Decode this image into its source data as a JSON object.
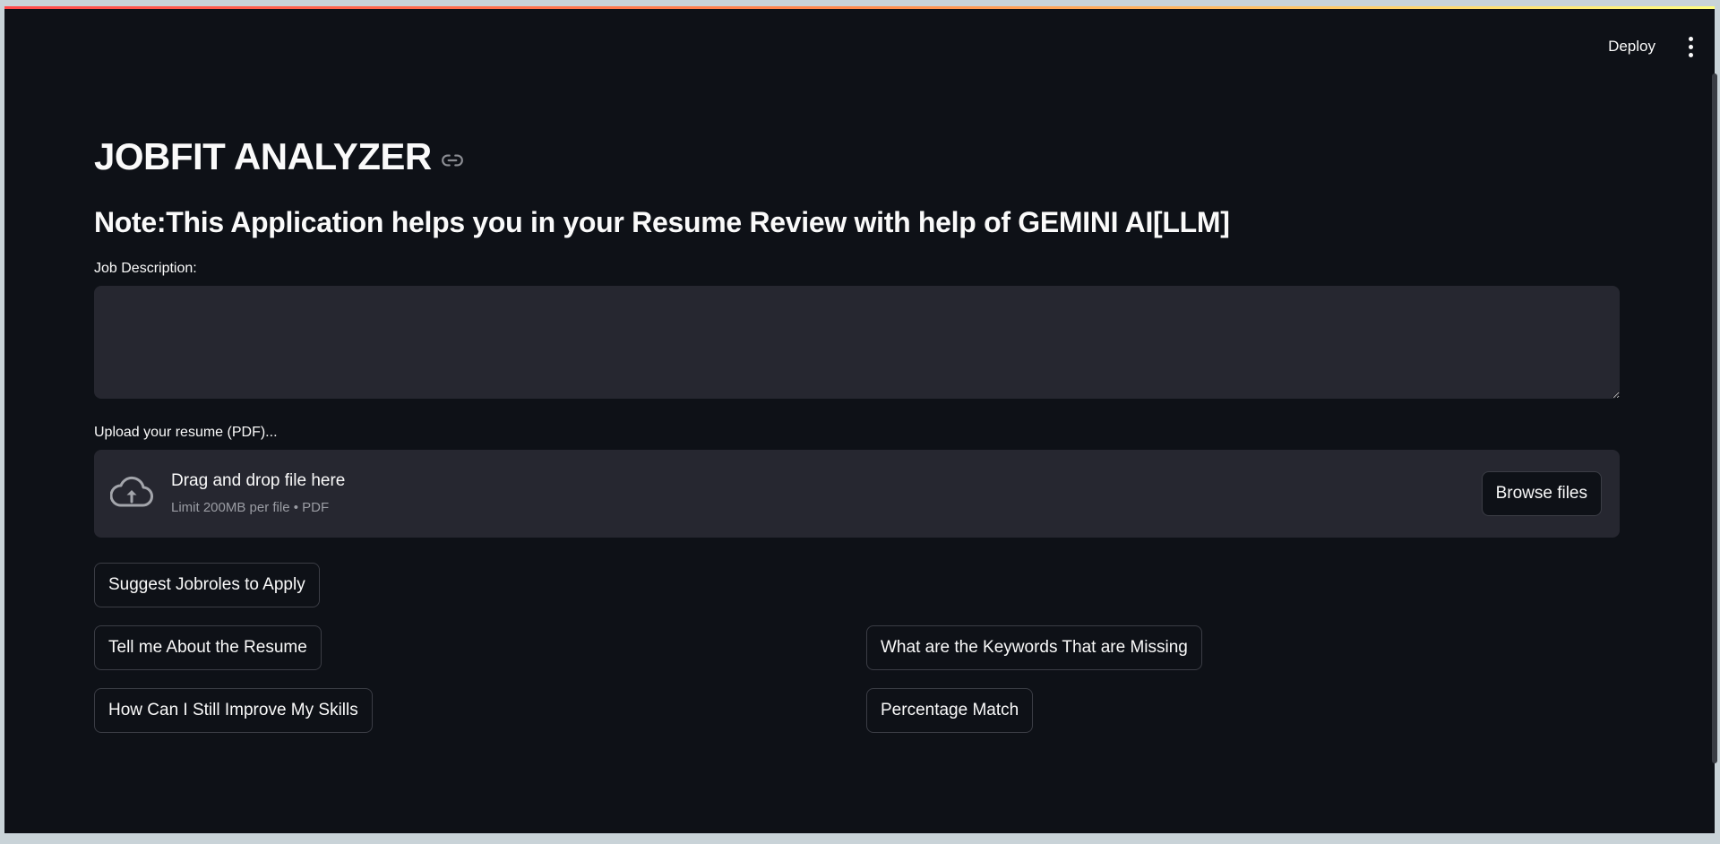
{
  "header": {
    "deploy_label": "Deploy",
    "menu_icon": "kebab-menu-icon"
  },
  "main": {
    "title": "JOBFIT ANALYZER",
    "subtitle": "Note:This Application helps you in your Resume Review with help of GEMINI AI[LLM]",
    "job_description": {
      "label": "Job Description:",
      "value": "",
      "placeholder": ""
    },
    "uploader": {
      "label": "Upload your resume (PDF)...",
      "drop_text": "Drag and drop file here",
      "limit_text": "Limit 200MB per file • PDF",
      "browse_label": "Browse files"
    },
    "buttons": {
      "suggest_jobroles": "Suggest Jobroles to Apply",
      "tell_about_resume": "Tell me About the Resume",
      "missing_keywords": "What are the Keywords That are Missing",
      "improve_skills": "How Can I Still Improve My Skills",
      "percentage_match": "Percentage Match"
    }
  },
  "colors": {
    "background": "#0e1117",
    "surface": "#262730",
    "border": "#3b3d45",
    "text": "#fafafa",
    "muted_text": "#9a9ca3",
    "accent_gradient_start": "#ff4b4b",
    "accent_gradient_end": "#fffd80"
  }
}
